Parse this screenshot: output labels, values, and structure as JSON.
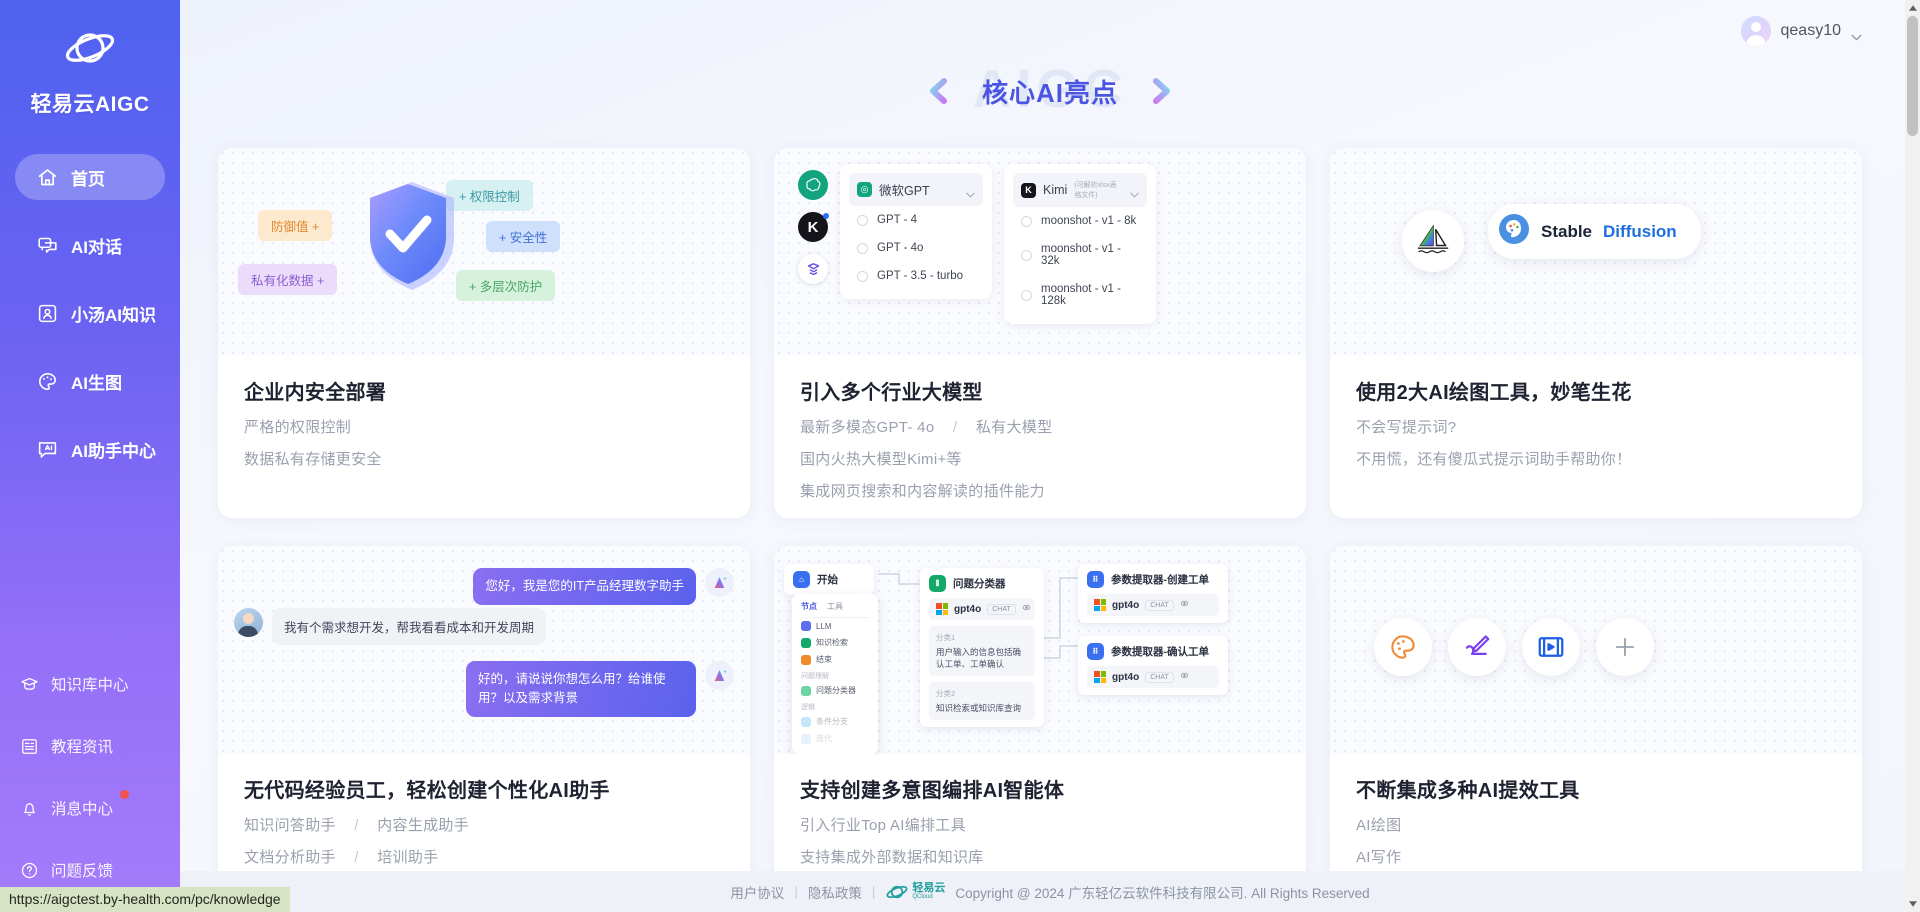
{
  "sidebar": {
    "brand": {
      "name": "轻易云AIGC",
      "logo_icon": "orbit-logo-icon"
    },
    "main_items": [
      {
        "label": "首页",
        "icon": "home-icon",
        "active": true
      },
      {
        "label": "AI对话",
        "icon": "chat-icon",
        "active": false
      },
      {
        "label": "小汤AI知识",
        "icon": "user-info-icon",
        "active": false
      },
      {
        "label": "AI生图",
        "icon": "palette-icon",
        "active": false
      },
      {
        "label": "AI助手中心",
        "icon": "assistant-icon",
        "active": false
      }
    ],
    "bottom_items": [
      {
        "label": "知识库中心",
        "icon": "graduation-cap-icon",
        "badge": false
      },
      {
        "label": "教程资讯",
        "icon": "news-icon",
        "badge": false
      },
      {
        "label": "消息中心",
        "icon": "bell-icon",
        "badge": true
      },
      {
        "label": "问题反馈",
        "icon": "question-circle-icon",
        "badge": false
      }
    ]
  },
  "topbar": {
    "user_name": "qeasy10",
    "avatar_icon": "avatar-icon",
    "chevron_icon": "chevron-down-icon"
  },
  "carousel": {
    "title": "核心AI亮点",
    "watermark": "AIGC",
    "prev_icon": "chevron-left-icon",
    "next_icon": "chevron-right-icon"
  },
  "cards": [
    {
      "id": "security",
      "title": "企业内安全部署",
      "lines": [
        "严格的权限控制",
        "数据私有存储更安全"
      ],
      "tags": [
        {
          "text": "防御值 +",
          "color": "orange"
        },
        {
          "text": "私有化数据 +",
          "color": "purple"
        },
        {
          "text": "+ 权限控制",
          "color": "cyan"
        },
        {
          "text": "+ 安全性",
          "color": "blue"
        },
        {
          "text": "+ 多层次防护",
          "color": "green"
        }
      ],
      "visual_icon": "shield-check-icon"
    },
    {
      "id": "models",
      "title": "引入多个行业大模型",
      "lines_rich": [
        {
          "left": "最新多模态GPT- 4o",
          "sep": "/",
          "right": "私有大模型"
        }
      ],
      "lines": [
        "国内火热大模型Kimi+等",
        "集成网页搜索和内容解读的插件能力"
      ],
      "brand_icons": [
        "openai-icon",
        "kimi-icon",
        "zhipu-icon"
      ],
      "panels": [
        {
          "header": "微软GPT",
          "header_sub": "",
          "options": [
            "GPT - 4",
            "GPT - 4o",
            "GPT - 3.5 - turbo"
          ]
        },
        {
          "header": "Kimi",
          "header_sub": "(可解析xlsx表格文件)",
          "options": [
            "moonshot - v1 - 8k",
            "moonshot - v1 - 32k",
            "moonshot - v1 - 128k"
          ]
        }
      ]
    },
    {
      "id": "drawing",
      "title": "使用2大AI绘图工具，妙笔生花",
      "lines": [
        "不会写提示词?",
        "不用慌，还有傻瓜式提示词助手帮助你！"
      ],
      "sd_label_1": "Stable",
      "sd_label_2": "Diffusion",
      "midjourney_icon": "sailboat-icon",
      "sd_icon": "brain-palette-icon"
    },
    {
      "id": "assistant",
      "title": "无代码经验员工，轻松创建个性化AI助手",
      "lines_rich": [
        {
          "left": "知识问答助手",
          "sep": "/",
          "right": "内容生成助手"
        },
        {
          "left": "文档分析助手",
          "sep": "/",
          "right": "培训助手"
        }
      ],
      "chat": [
        {
          "side": "ai",
          "text": "您好，我是您的IT产品经理数字助手"
        },
        {
          "side": "user",
          "text": "我有个需求想开发，帮我看看成本和开发周期"
        },
        {
          "side": "ai",
          "text": "好的，请说说你想怎么用？给谁使用？以及需求背景"
        }
      ]
    },
    {
      "id": "workflow",
      "title": "支持创建多意图编排AI智能体",
      "lines": [
        "引入行业Top AI编排工具",
        "支持集成外部数据和知识库"
      ],
      "nodes": [
        {
          "name": "开始",
          "icon": "home-node-icon"
        },
        {
          "name": "问题分类器",
          "icon": "classifier-node-icon",
          "model": "gpt4o",
          "chip": "CHAT",
          "branches": [
            {
              "label": "分类1",
              "text": "用户输入的信息包括确认工单、工单确认"
            },
            {
              "label": "分类2",
              "text": "知识检索或知识库查询"
            }
          ]
        },
        {
          "name": "参数提取器-创建工单",
          "icon": "extractor-node-icon",
          "model": "gpt4o",
          "chip": "CHAT"
        },
        {
          "name": "参数提取器-确认工单",
          "icon": "extractor-node-icon",
          "model": "gpt4o",
          "chip": "CHAT"
        }
      ],
      "menu": {
        "tabs": [
          "节点",
          "工具"
        ],
        "items": [
          "LLM",
          "知识检索",
          "结束"
        ],
        "section_1": "问题理解",
        "items_2": [
          "问题分类器"
        ],
        "section_2": "逻辑",
        "items_3": [
          "条件分支",
          "迭代"
        ]
      }
    },
    {
      "id": "tools",
      "title": "不断集成多种AI提效工具",
      "lines": [
        "AI绘图",
        "AI写作"
      ],
      "tool_icons": [
        "palette-tool-icon",
        "pen-tool-icon",
        "video-tool-icon",
        "plus-tool-icon"
      ]
    }
  ],
  "footer": {
    "links": [
      "用户协议",
      "隐私政策"
    ],
    "logo_text": "轻易云",
    "logo_sub": "QCloud",
    "copyright": "Copyright @ 2024 广东轻亿云软件科技有限公司. All Rights Reserved"
  },
  "status_bar": {
    "url": "https://aigctest.by-health.com/pc/knowledge"
  },
  "scrollbar": {
    "up_icon": "scroll-up-icon",
    "down_icon": "scroll-down-icon"
  }
}
